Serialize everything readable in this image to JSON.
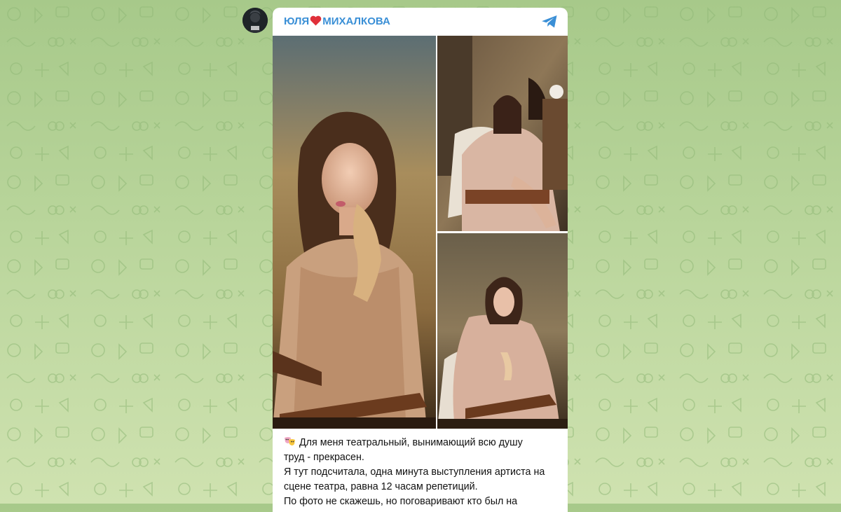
{
  "channel": {
    "name_before": "ЮЛЯ",
    "name_after": "МИХАЛКОВА",
    "heart_icon": "red-heart-icon",
    "share_icon": "telegram-icon",
    "avatar_icon": "channel-avatar"
  },
  "post": {
    "photos": [
      {
        "id": "photo-1"
      },
      {
        "id": "photo-2"
      },
      {
        "id": "photo-3"
      }
    ],
    "text_lines": [
      "Для меня театральный, вынимающий всю душу",
      "труд - прекрасен.",
      "Я тут подсчитала, одна минута выступления артиста на",
      "сцене театра, равна 12 часам репетиций.",
      "По фото не скажешь, но поговаривают кто был на"
    ],
    "emoji_icon": "performing-arts-masks-icon"
  },
  "colors": {
    "channel_name": "#3a8fd6",
    "heart": "#e0303a",
    "background_top": "#a7c98a",
    "background_bottom": "#cfe2b0"
  }
}
